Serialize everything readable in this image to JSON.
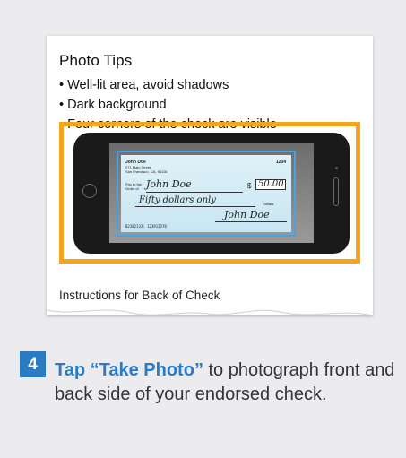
{
  "photo_tips": {
    "title": "Photo Tips",
    "items": [
      "Well-lit area, avoid shadows",
      "Dark background",
      "Four corners of the check are visible"
    ]
  },
  "check": {
    "name": "John Doe",
    "address_line1": "271 Main Street",
    "address_line2": "San Francisco, CA, 94118",
    "number": "1234",
    "pay_to_label": "Pay to the Order of",
    "payee": "John Doe",
    "amount": "50.00",
    "dollar_sign": "$",
    "amount_words": "Fifty dollars only",
    "dollars_label": "Dollars",
    "signature": "John Doe",
    "micr": "B2382132: 123912378"
  },
  "back_caption": "Instructions for Back of Check",
  "step": {
    "number": "4",
    "emphasis": "Tap “Take Photo”",
    "rest": " to photograph front and back side of your endorsed check."
  },
  "colors": {
    "accent": "#2b7bc4",
    "frame": "#f5a519",
    "background": "#ececee"
  }
}
